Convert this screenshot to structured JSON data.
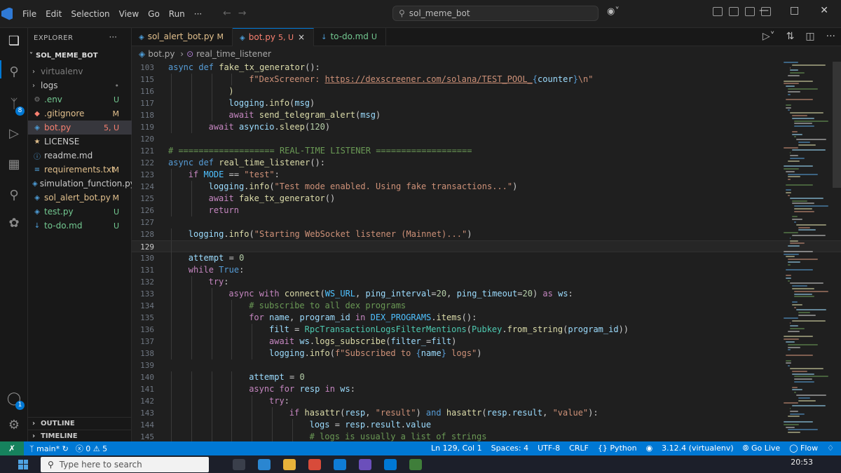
{
  "titlebar": {
    "menu": [
      "File",
      "Edit",
      "Selection",
      "View",
      "Go",
      "Run",
      "···"
    ],
    "search_text": "sol_meme_bot"
  },
  "activitybar": {
    "scm_badge": "8",
    "accounts_badge": "1"
  },
  "sidebar": {
    "title": "EXPLORER",
    "more": "···",
    "folder": "SOL_MEME_BOT",
    "items": [
      {
        "name": "virtualenv",
        "status": "",
        "icon": "chevron-right",
        "color": "dim"
      },
      {
        "name": "logs",
        "status": "•",
        "icon": "chevron-right",
        "color": "dim"
      },
      {
        "name": ".env",
        "status": "U",
        "icon": "gear",
        "color": "green"
      },
      {
        "name": ".gitignore",
        "status": "M",
        "icon": "git",
        "color": "yellow"
      },
      {
        "name": "bot.py",
        "status": "5, U",
        "icon": "python",
        "color": "red"
      },
      {
        "name": "LICENSE",
        "status": "",
        "icon": "license",
        "color": "norm"
      },
      {
        "name": "readme.md",
        "status": "",
        "icon": "info",
        "color": "norm"
      },
      {
        "name": "requirements.txt",
        "status": "M",
        "icon": "list",
        "color": "yellow"
      },
      {
        "name": "simulation_function.py",
        "status": "",
        "icon": "python",
        "color": "norm"
      },
      {
        "name": "sol_alert_bot.py",
        "status": "M",
        "icon": "python",
        "color": "yellow"
      },
      {
        "name": "test.py",
        "status": "U",
        "icon": "python",
        "color": "green"
      },
      {
        "name": "to-do.md",
        "status": "U",
        "icon": "markdown",
        "color": "green"
      }
    ],
    "outline": "OUTLINE",
    "timeline": "TIMELINE"
  },
  "tabs": [
    {
      "label": "sol_alert_bot.py",
      "mark": "M",
      "color": "yellow",
      "active": false
    },
    {
      "label": "bot.py",
      "mark": "5, U",
      "color": "red",
      "active": true,
      "close": "×"
    },
    {
      "label": "to-do.md",
      "mark": "U",
      "color": "green",
      "active": false
    }
  ],
  "breadcrumb": {
    "file": "bot.py",
    "separator": "›",
    "symbol": "real_time_listener"
  },
  "code": [
    {
      "n": "103",
      "i": 0,
      "t": [
        [
          "kw",
          "async "
        ],
        [
          "kw",
          "def "
        ],
        [
          "fn",
          "fake_tx_generator"
        ],
        [
          "p",
          "():"
        ]
      ]
    },
    {
      "n": "115",
      "i": 4,
      "t": [
        [
          "str",
          "f\"DexScreener: "
        ],
        [
          "lnk",
          "https://dexscreener.com/solana/TEST_POOL_"
        ],
        [
          "kw",
          "{"
        ],
        [
          "vr",
          "counter"
        ],
        [
          "kw",
          "}"
        ],
        [
          "str",
          "\\n\""
        ]
      ]
    },
    {
      "n": "116",
      "i": 3,
      "t": [
        [
          "fn",
          ")"
        ]
      ]
    },
    {
      "n": "117",
      "i": 3,
      "t": [
        [
          "vr",
          "logging"
        ],
        [
          "p",
          "."
        ],
        [
          "fn",
          "info"
        ],
        [
          "p",
          "("
        ],
        [
          "vr",
          "msg"
        ],
        [
          "p",
          ")"
        ]
      ]
    },
    {
      "n": "118",
      "i": 3,
      "t": [
        [
          "ctl",
          "await "
        ],
        [
          "fn",
          "send_telegram_alert"
        ],
        [
          "p",
          "("
        ],
        [
          "vr",
          "msg"
        ],
        [
          "p",
          ")"
        ]
      ]
    },
    {
      "n": "119",
      "i": 2,
      "t": [
        [
          "ctl",
          "await "
        ],
        [
          "vr",
          "asyncio"
        ],
        [
          "p",
          "."
        ],
        [
          "fn",
          "sleep"
        ],
        [
          "p",
          "("
        ],
        [
          "num",
          "120"
        ],
        [
          "p",
          ")"
        ]
      ]
    },
    {
      "n": "120",
      "i": 0,
      "t": []
    },
    {
      "n": "121",
      "i": 0,
      "t": [
        [
          "cm",
          "# =================== REAL-TIME LISTENER ==================="
        ]
      ]
    },
    {
      "n": "122",
      "i": 0,
      "t": [
        [
          "kw",
          "async "
        ],
        [
          "kw",
          "def "
        ],
        [
          "fn",
          "real_time_listener"
        ],
        [
          "p",
          "():"
        ]
      ]
    },
    {
      "n": "123",
      "i": 1,
      "t": [
        [
          "ctl",
          "if "
        ],
        [
          "const",
          "MODE"
        ],
        [
          "p",
          " == "
        ],
        [
          "str",
          "\"test\""
        ],
        [
          "p",
          ":"
        ]
      ]
    },
    {
      "n": "124",
      "i": 2,
      "t": [
        [
          "vr",
          "logging"
        ],
        [
          "p",
          "."
        ],
        [
          "fn",
          "info"
        ],
        [
          "p",
          "("
        ],
        [
          "str",
          "\"Test mode enabled. Using fake transactions...\""
        ],
        [
          "p",
          ")"
        ]
      ]
    },
    {
      "n": "125",
      "i": 2,
      "t": [
        [
          "ctl",
          "await "
        ],
        [
          "fn",
          "fake_tx_generator"
        ],
        [
          "p",
          "()"
        ]
      ]
    },
    {
      "n": "126",
      "i": 2,
      "t": [
        [
          "ctl",
          "return"
        ]
      ]
    },
    {
      "n": "127",
      "i": 0,
      "t": []
    },
    {
      "n": "128",
      "i": 1,
      "t": [
        [
          "vr",
          "logging"
        ],
        [
          "p",
          "."
        ],
        [
          "fn",
          "info"
        ],
        [
          "p",
          "("
        ],
        [
          "str",
          "\"Starting WebSocket listener (Mainnet)...\""
        ],
        [
          "p",
          ")"
        ]
      ]
    },
    {
      "n": "129",
      "i": 1,
      "t": [],
      "cur": true
    },
    {
      "n": "130",
      "i": 1,
      "t": [
        [
          "vr",
          "attempt"
        ],
        [
          "p",
          " = "
        ],
        [
          "num",
          "0"
        ]
      ]
    },
    {
      "n": "131",
      "i": 1,
      "t": [
        [
          "ctl",
          "while "
        ],
        [
          "kw",
          "True"
        ],
        [
          "p",
          ":"
        ]
      ]
    },
    {
      "n": "132",
      "i": 2,
      "t": [
        [
          "ctl",
          "try"
        ],
        [
          "p",
          ":"
        ]
      ]
    },
    {
      "n": "133",
      "i": 3,
      "t": [
        [
          "ctl",
          "async "
        ],
        [
          "ctl",
          "with "
        ],
        [
          "fn",
          "connect"
        ],
        [
          "p",
          "("
        ],
        [
          "const",
          "WS_URL"
        ],
        [
          "p",
          ", "
        ],
        [
          "vr",
          "ping_interval"
        ],
        [
          "p",
          "="
        ],
        [
          "num",
          "20"
        ],
        [
          "p",
          ", "
        ],
        [
          "vr",
          "ping_timeout"
        ],
        [
          "p",
          "="
        ],
        [
          "num",
          "20"
        ],
        [
          "p",
          ") "
        ],
        [
          "ctl",
          "as "
        ],
        [
          "vr",
          "ws"
        ],
        [
          "p",
          ":"
        ]
      ]
    },
    {
      "n": "134",
      "i": 4,
      "t": [
        [
          "cm",
          "# subscribe to all dex programs"
        ]
      ]
    },
    {
      "n": "135",
      "i": 4,
      "t": [
        [
          "ctl",
          "for "
        ],
        [
          "vr",
          "name"
        ],
        [
          "p",
          ", "
        ],
        [
          "vr",
          "program_id"
        ],
        [
          "ctl",
          " in "
        ],
        [
          "const",
          "DEX_PROGRAMS"
        ],
        [
          "p",
          "."
        ],
        [
          "fn",
          "items"
        ],
        [
          "p",
          "():"
        ]
      ]
    },
    {
      "n": "136",
      "i": 5,
      "t": [
        [
          "vr",
          "filt"
        ],
        [
          "p",
          " = "
        ],
        [
          "cls",
          "RpcTransactionLogsFilterMentions"
        ],
        [
          "p",
          "("
        ],
        [
          "cls",
          "Pubkey"
        ],
        [
          "p",
          "."
        ],
        [
          "fn",
          "from_string"
        ],
        [
          "p",
          "("
        ],
        [
          "vr",
          "program_id"
        ],
        [
          "p",
          "))"
        ]
      ]
    },
    {
      "n": "137",
      "i": 5,
      "t": [
        [
          "ctl",
          "await "
        ],
        [
          "vr",
          "ws"
        ],
        [
          "p",
          "."
        ],
        [
          "fn",
          "logs_subscribe"
        ],
        [
          "p",
          "("
        ],
        [
          "vr",
          "filter_"
        ],
        [
          "p",
          "="
        ],
        [
          "vr",
          "filt"
        ],
        [
          "p",
          ")"
        ]
      ]
    },
    {
      "n": "138",
      "i": 5,
      "t": [
        [
          "vr",
          "logging"
        ],
        [
          "p",
          "."
        ],
        [
          "fn",
          "info"
        ],
        [
          "p",
          "("
        ],
        [
          "str",
          "f\"Subscribed to "
        ],
        [
          "kw",
          "{"
        ],
        [
          "vr",
          "name"
        ],
        [
          "kw",
          "}"
        ],
        [
          "str",
          " logs\""
        ],
        [
          "p",
          ")"
        ]
      ]
    },
    {
      "n": "139",
      "i": 0,
      "t": []
    },
    {
      "n": "140",
      "i": 4,
      "t": [
        [
          "vr",
          "attempt"
        ],
        [
          "p",
          " = "
        ],
        [
          "num",
          "0"
        ]
      ]
    },
    {
      "n": "141",
      "i": 4,
      "t": [
        [
          "ctl",
          "async "
        ],
        [
          "ctl",
          "for "
        ],
        [
          "vr",
          "resp"
        ],
        [
          "ctl",
          " in "
        ],
        [
          "vr",
          "ws"
        ],
        [
          "p",
          ":"
        ]
      ]
    },
    {
      "n": "142",
      "i": 5,
      "t": [
        [
          "ctl",
          "try"
        ],
        [
          "p",
          ":"
        ]
      ]
    },
    {
      "n": "143",
      "i": 6,
      "t": [
        [
          "ctl",
          "if "
        ],
        [
          "fn",
          "hasattr"
        ],
        [
          "p",
          "("
        ],
        [
          "vr",
          "resp"
        ],
        [
          "p",
          ", "
        ],
        [
          "str",
          "\"result\""
        ],
        [
          "p",
          ") "
        ],
        [
          "kw",
          "and "
        ],
        [
          "fn",
          "hasattr"
        ],
        [
          "p",
          "("
        ],
        [
          "vr",
          "resp"
        ],
        [
          "p",
          "."
        ],
        [
          "vr",
          "result"
        ],
        [
          "p",
          ", "
        ],
        [
          "str",
          "\"value\""
        ],
        [
          "p",
          "):"
        ]
      ]
    },
    {
      "n": "144",
      "i": 7,
      "t": [
        [
          "vr",
          "logs"
        ],
        [
          "p",
          " = "
        ],
        [
          "vr",
          "resp"
        ],
        [
          "p",
          "."
        ],
        [
          "vr",
          "result"
        ],
        [
          "p",
          "."
        ],
        [
          "vr",
          "value"
        ]
      ]
    },
    {
      "n": "145",
      "i": 7,
      "t": [
        [
          "cm",
          "# logs is usually a list of strings"
        ]
      ]
    }
  ],
  "statusbar": {
    "branch": "main*",
    "problems": "ⓧ 0 ⚠ 5",
    "position": "Ln 129, Col 1",
    "spaces": "Spaces: 4",
    "encoding": "UTF-8",
    "eol": "CRLF",
    "language": "Python",
    "interpreter": "3.12.4 (virtualenv)",
    "golive": "Go Live",
    "flow": "Flow"
  },
  "taskbar": {
    "search_placeholder": "Type here to search",
    "clock": "20:53"
  }
}
